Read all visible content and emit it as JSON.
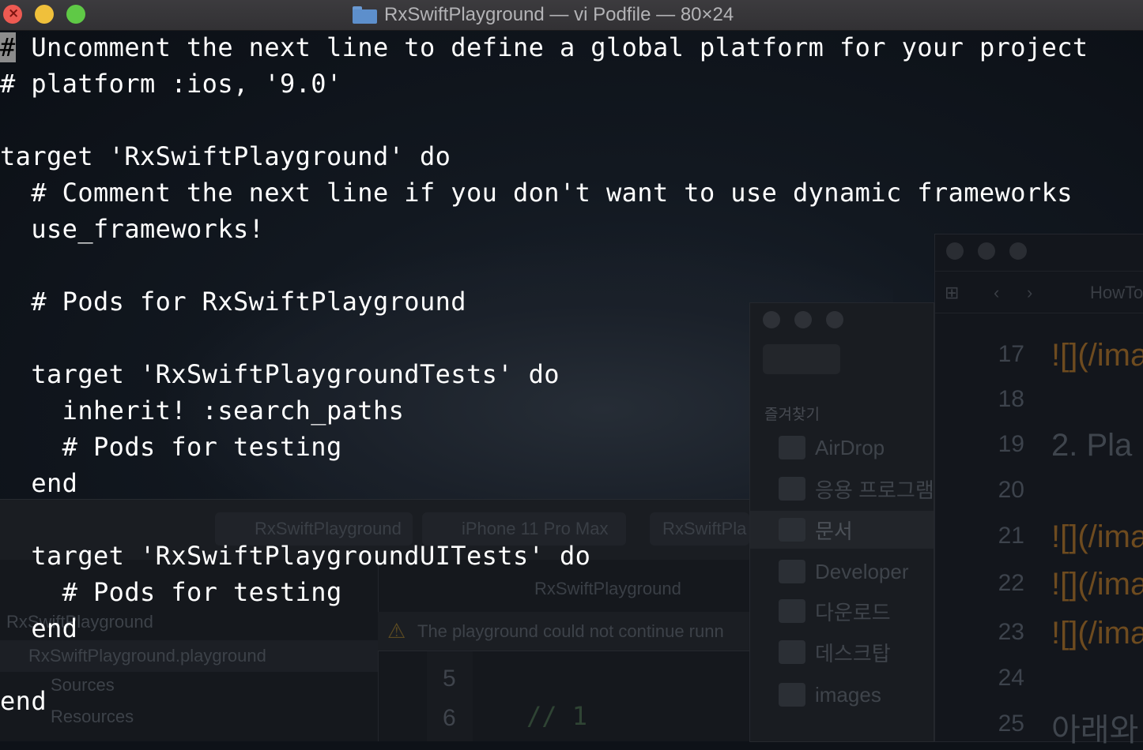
{
  "window": {
    "title": "RxSwiftPlayground — vi Podfile — 80×24"
  },
  "terminal": {
    "cursor_char": "#",
    "lines": [
      " Uncomment the next line to define a global platform for your project",
      "# platform :ios, '9.0'",
      "",
      "target 'RxSwiftPlayground' do",
      "  # Comment the next line if you don't want to use dynamic frameworks",
      "  use_frameworks!",
      "",
      "  # Pods for RxSwiftPlayground",
      "",
      "  target 'RxSwiftPlaygroundTests' do",
      "    inherit! :search_paths",
      "    # Pods for testing",
      "  end",
      "",
      "",
      "  target 'RxSwiftPlaygroundUITests' do",
      "    # Pods for testing",
      "  end",
      "",
      "end"
    ]
  },
  "background": {
    "markdown_editor": {
      "tab": "HowTo",
      "line_numbers": [
        "17",
        "18",
        "19",
        "20",
        "21",
        "22",
        "23",
        "24",
        "25"
      ],
      "texts": [
        "![](/ima",
        "2. Pla",
        "![](/ima",
        "![](/ima",
        "![](/ima",
        "아래와"
      ]
    },
    "finder": {
      "section": "즐겨찾기",
      "items": [
        "AirDrop",
        "응용 프로그램",
        "문서",
        "Developer",
        "다운로드",
        "데스크탑",
        "images"
      ]
    },
    "xcode": {
      "scheme": "RxSwiftPlayground",
      "device": "iPhone 11 Pro Max",
      "status": "RxSwiftPla",
      "breadcrumb": "RxSwiftPlayground",
      "warning": "The playground could not continue runn",
      "nav_title": "RxSwiftPlayground",
      "nav_items": [
        "RxSwiftPlayground.playground",
        "Sources",
        "Resources"
      ],
      "line_numbers": [
        "5",
        "6"
      ],
      "code": "// 1"
    }
  },
  "colors": {
    "terminal_text": "#ffffff",
    "cursor": "#8c8c8c",
    "titlebar": "#38373a"
  }
}
